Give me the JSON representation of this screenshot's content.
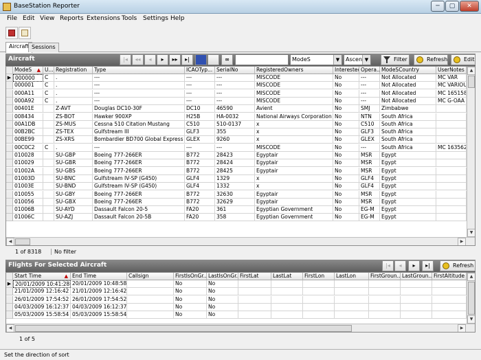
{
  "window": {
    "title": "BaseStation Reporter",
    "min": "─",
    "max": "▢",
    "close": "✕"
  },
  "menu": [
    "File",
    "Edit",
    "View",
    "Reports",
    "Extensions",
    "Tools",
    "Settings",
    "Help"
  ],
  "tabs": [
    {
      "label": "Aircraft",
      "active": true
    },
    {
      "label": "Sessions",
      "active": false
    }
  ],
  "aircraft_panel": {
    "title": "Aircraft",
    "search_value": "",
    "field_select": "ModeS",
    "order_select": "Ascenc",
    "filter_label": "Filter",
    "refresh_label": "Refresh",
    "edit_label": "Edit",
    "nav": [
      "|◂",
      "◂◂",
      "◂",
      "▸",
      "▸▸",
      "▸|"
    ],
    "columns": [
      "ModeS",
      "U...",
      "Registration",
      "Type",
      "ICAOTyp...",
      "SerialNo",
      "RegisteredOwners",
      "Interested",
      "Opera...",
      "ModeSCountry",
      "UserNotes"
    ],
    "rows": [
      [
        "000000",
        "C",
        ".",
        "---",
        "---",
        "---",
        "MISCODE",
        "No",
        "---",
        "Not Allocated",
        "MC VAR"
      ],
      [
        "000001",
        "C",
        ".",
        "---",
        "---",
        "---",
        "MISCODE",
        "No",
        "---",
        "Not Allocated",
        "MC VARIOU"
      ],
      [
        "000A11",
        "C",
        ".",
        "---",
        "---",
        "---",
        "MISCODE",
        "No",
        "---",
        "Not Allocated",
        "MC 165158"
      ],
      [
        "000A92",
        "C",
        ".",
        "---",
        "---",
        "---",
        "MISCODE",
        "No",
        "---",
        "Not Allocated",
        "MC G-OAA"
      ],
      [
        "00401E",
        "",
        "Z-AVT",
        "Douglas DC10-30F",
        "DC10",
        "46590",
        "Avient",
        "No",
        "SMJ",
        "Zimbabwe",
        ""
      ],
      [
        "008434",
        "",
        "ZS-BOT",
        "Hawker 900XP",
        "H25B",
        "HA-0032",
        "National Airways Corporation",
        "No",
        "NTN",
        "South Africa",
        ""
      ],
      [
        "00A1DB",
        "",
        "ZS-MUS",
        "Cessna 510 Citation Mustang",
        "C510",
        "510-0137",
        "x",
        "No",
        "C510",
        "South Africa",
        ""
      ],
      [
        "00B2BC",
        "",
        "ZS-TEX",
        "Gulfstream III",
        "GLF3",
        "355",
        "x",
        "No",
        "GLF3",
        "South Africa",
        ""
      ],
      [
        "00BE99",
        "",
        "ZS-XRS",
        "Bombardier BD700 Global Express",
        "GLEX",
        "9260",
        "x",
        "No",
        "GLEX",
        "South Africa",
        ""
      ],
      [
        "00C0C2",
        "C",
        ".",
        "---",
        "---",
        "---",
        "MISCODE",
        "No",
        "---",
        "South Africa",
        "MC 163562"
      ],
      [
        "010028",
        "",
        "SU-GBP",
        "Boeing 777-266ER",
        "B772",
        "28423",
        "Egyptair",
        "No",
        "MSR",
        "Egypt",
        ""
      ],
      [
        "010029",
        "",
        "SU-GBR",
        "Boeing 777-266ER",
        "B772",
        "28424",
        "Egyptair",
        "No",
        "MSR",
        "Egypt",
        ""
      ],
      [
        "01002A",
        "",
        "SU-GBS",
        "Boeing 777-266ER",
        "B772",
        "28425",
        "Egyptair",
        "No",
        "MSR",
        "Egypt",
        ""
      ],
      [
        "01003D",
        "",
        "SU-BNC",
        "Gulfstream IV-SP (G450)",
        "GLF4",
        "1329",
        "x",
        "No",
        "GLF4",
        "Egypt",
        ""
      ],
      [
        "01003E",
        "",
        "SU-BND",
        "Gulfstream IV-SP (G450)",
        "GLF4",
        "1332",
        "x",
        "No",
        "GLF4",
        "Egypt",
        ""
      ],
      [
        "010055",
        "",
        "SU-GBY",
        "Boeing 777-266ER",
        "B772",
        "32630",
        "Egyptair",
        "No",
        "MSR",
        "Egypt",
        ""
      ],
      [
        "010056",
        "",
        "SU-GBX",
        "Boeing 777-266ER",
        "B772",
        "32629",
        "Egyptair",
        "No",
        "MSR",
        "Egypt",
        ""
      ],
      [
        "01006B",
        "",
        "SU-AYD",
        "Dassault Falcon 20-5",
        "FA20",
        "361",
        "Egyptian Government",
        "No",
        "EG-M",
        "Egypt",
        ""
      ],
      [
        "01006C",
        "",
        "SU-AZJ",
        "Dassault Falcon 20-5B",
        "FA20",
        "358",
        "Egyptian Government",
        "No",
        "EG-M",
        "Egypt",
        ""
      ]
    ],
    "record_pos": "1 of 8318",
    "filter_state": "No filter"
  },
  "flights_panel": {
    "title": "Flights For Selected Aircraft",
    "refresh_label": "Refresh",
    "nav": [
      "|◂",
      "◂",
      "▸",
      "▸|"
    ],
    "columns": [
      "Start Time",
      "End Time",
      "Callsign",
      "FirstIsOnGr...",
      "LastIsOnGr...",
      "FirstLat",
      "LastLat",
      "FirstLon",
      "LastLon",
      "FirstGroun...",
      "LastGroun...",
      "FirstAltitude"
    ],
    "rows": [
      [
        "20/01/2009 10:41:28",
        "20/01/2009 10:48:58",
        "",
        "No",
        "No"
      ],
      [
        "21/01/2009 12:16:42",
        "21/01/2009 12:16:42",
        "",
        "No",
        "No"
      ],
      [
        "26/01/2009 17:54:52",
        "26/01/2009 17:54:52",
        "",
        "No",
        "No"
      ],
      [
        "04/03/2009 16:12:37",
        "04/03/2009 16:12:37",
        "",
        "No",
        "No"
      ],
      [
        "05/03/2009 15:58:54",
        "05/03/2009 15:58:54",
        "",
        "No",
        "No"
      ]
    ],
    "record_pos": "1 of 5"
  },
  "status": "Set the direction of sort",
  "colors": {
    "panel_header": "#6e6e6e",
    "sort_arrow": "#c00000",
    "selected_row_marker": "#000000"
  },
  "icons": [
    "app-icon",
    "report-icon",
    "map-icon",
    "search-binoculars-icon",
    "filter-icon",
    "refresh-icon",
    "edit-icon",
    "sort-arrow-icon"
  ]
}
